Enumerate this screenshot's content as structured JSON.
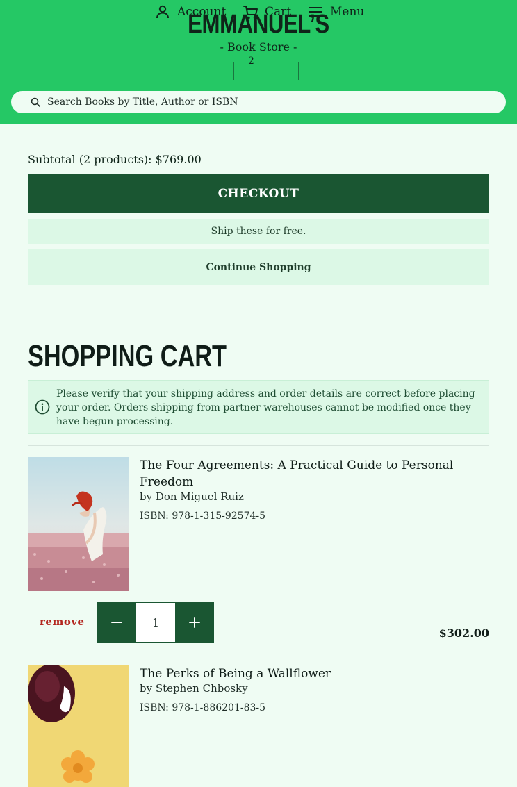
{
  "header": {
    "logo": "EMMANUEL’S",
    "subtitle": "- Book Store -",
    "nav": {
      "account_label": "Account",
      "cart_label": "Cart",
      "cart_count": "2",
      "menu_label": "Menu"
    },
    "search": {
      "placeholder": "Search Books by Title, Author or ISBN"
    }
  },
  "summary": {
    "subtotal": "Subtotal (2 products): $769.00",
    "checkout_label": "CHECKOUT",
    "ship_free": "Ship these for free.",
    "continue_label": "Continue Shopping"
  },
  "cart": {
    "title": "SHOPPING CART",
    "notice": "Please verify that your shipping address and order details are correct before placing your order. Orders shipping from partner warehouses cannot be modified once they have begun processing.",
    "items": [
      {
        "title": "The Four Agreements: A Practical Guide to Personal Freedom",
        "author": "by Don Miguel Ruiz",
        "isbn": "ISBN: 978-1-315-92574-5",
        "remove_label": "remove",
        "quantity": "1",
        "price": "$302.00"
      },
      {
        "title": "The Perks of Being a Wallflower",
        "author": "by Stephen Chbosky",
        "isbn": "ISBN: 978-1-886201-83-5"
      }
    ]
  },
  "colors": {
    "header_bg": "#25c865",
    "page_bg": "#effcf3",
    "primary_dark": "#1a5632",
    "light_panel": "#dcf8e6",
    "remove_red": "#b3261e"
  },
  "icons": [
    "user-icon",
    "cart-icon",
    "menu-icon",
    "search-icon",
    "info-icon",
    "minus-icon",
    "plus-icon"
  ]
}
